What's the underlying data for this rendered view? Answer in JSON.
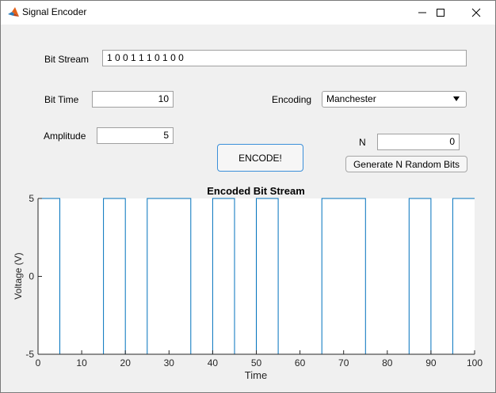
{
  "window": {
    "title": "Signal Encoder",
    "controls": [
      "minimize",
      "maximize",
      "close"
    ]
  },
  "form": {
    "bit_stream_label": "Bit Stream",
    "bit_stream_value": "1 0 0 1 1 1 0 1 0 0",
    "bit_time_label": "Bit  Time",
    "bit_time_value": "10",
    "amplitude_label": "Amplitude",
    "amplitude_value": "5",
    "encoding_label": "Encoding",
    "encoding_value": "Manchester",
    "n_label": "N",
    "n_value": "0",
    "encode_button": "ENCODE!",
    "random_button": "Generate N Random Bits"
  },
  "chart_data": {
    "type": "line",
    "title": "Encoded Bit Stream",
    "xlabel": "Time",
    "ylabel": "Voltage (V)",
    "xlim": [
      0,
      100
    ],
    "ylim": [
      -5,
      5
    ],
    "xticks": [
      0,
      10,
      20,
      30,
      40,
      50,
      60,
      70,
      80,
      90,
      100
    ],
    "yticks": [
      -5,
      0,
      5
    ],
    "grid": false,
    "color": "#0072bd",
    "series": [
      {
        "x": [
          0,
          5,
          5,
          15,
          15,
          20,
          20,
          25,
          25,
          35,
          35,
          40,
          40,
          45,
          45,
          50,
          50,
          55,
          55,
          65,
          65,
          75,
          75,
          85,
          85,
          90,
          90,
          95,
          95,
          100
        ],
        "y": [
          5,
          5,
          -5,
          -5,
          5,
          5,
          -5,
          -5,
          5,
          5,
          -5,
          -5,
          5,
          5,
          -5,
          -5,
          5,
          5,
          -5,
          -5,
          5,
          5,
          -5,
          -5,
          5,
          5,
          -5,
          -5,
          5,
          5
        ]
      }
    ]
  }
}
